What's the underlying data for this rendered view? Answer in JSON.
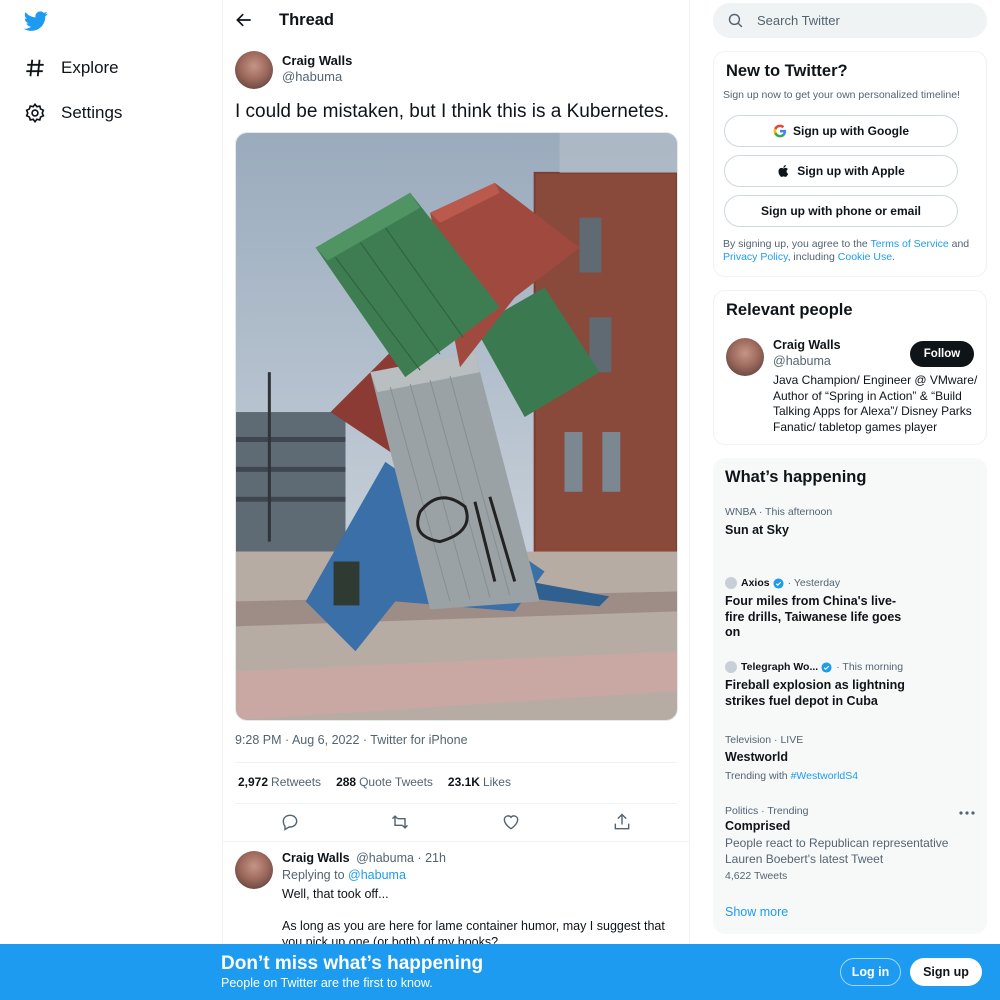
{
  "nav": {
    "logo_icon": "twitter-bird-icon",
    "items": [
      {
        "label": "Explore",
        "icon": "hashtag-icon"
      },
      {
        "label": "Settings",
        "icon": "gear-icon"
      }
    ]
  },
  "header": {
    "title": "Thread"
  },
  "tweet": {
    "name": "Craig Walls",
    "handle": "@habuma",
    "text": "I could be mistaken, but I think this is a Kubernetes.",
    "meta": "9:28 PM · Aug 6, 2022 · Twitter for iPhone",
    "stats": {
      "retweets": "2,972",
      "retweets_label": "Retweets",
      "quotes": "288",
      "quotes_label": "Quote Tweets",
      "likes": "23.1K",
      "likes_label": "Likes"
    }
  },
  "reply": {
    "name": "Craig Walls",
    "handle_time": "@habuma · 21h",
    "replying_prefix": "Replying to",
    "replying_to": "@habuma",
    "line1": "Well, that took off...",
    "line2": "As long as you are here for lame container humor, may I suggest that you pick up one (or both) of my books?"
  },
  "search": {
    "placeholder": "Search Twitter"
  },
  "new_to_twitter": {
    "title": "New to Twitter?",
    "subtitle": "Sign up now to get your own personalized timeline!",
    "google": "Sign up with Google",
    "apple": "Sign up with Apple",
    "phone": "Sign up with phone or email",
    "legal_1": "By signing up, you agree to the",
    "terms": "Terms of Service",
    "legal_2": "and",
    "privacy": "Privacy Policy",
    "legal_3": ", including",
    "cookie": "Cookie Use",
    "legal_4": "."
  },
  "relevant": {
    "title": "Relevant people",
    "name": "Craig Walls",
    "handle": "@habuma",
    "follow": "Follow",
    "bio": "Java Champion/ Engineer @ VMware/ Author of “Spring in Action” & “Build Talking Apps for Alexa”/ Disney Parks Fanatic/ tabletop games player"
  },
  "happening": {
    "title": "What’s happening",
    "trends": [
      {
        "context": "WNBA · This afternoon",
        "name": "Sun at Sky"
      },
      {
        "source": "Axios",
        "time": "· Yesterday",
        "name": "Four miles from China's live-fire drills, Taiwanese life goes on"
      },
      {
        "source": "Telegraph Wo...",
        "time": "· This morning",
        "name": "Fireball explosion as lightning strikes fuel depot in Cuba"
      },
      {
        "context": "Television · LIVE",
        "name": "Westworld",
        "sub_prefix": "Trending with",
        "sub_link": "#WestworldS4"
      },
      {
        "context": "Politics · Trending",
        "name": "Comprised",
        "desc": "People react to Republican representative Lauren Boebert's latest Tweet",
        "count": "4,622 Tweets"
      }
    ],
    "show_more": "Show more"
  },
  "banner": {
    "title": "Don’t miss what’s happening",
    "subtitle": "People on Twitter are the first to know.",
    "login": "Log in",
    "signup": "Sign up"
  },
  "colors": {
    "accent": "#1d9bf0",
    "text": "#0f1419",
    "muted": "#536471"
  }
}
